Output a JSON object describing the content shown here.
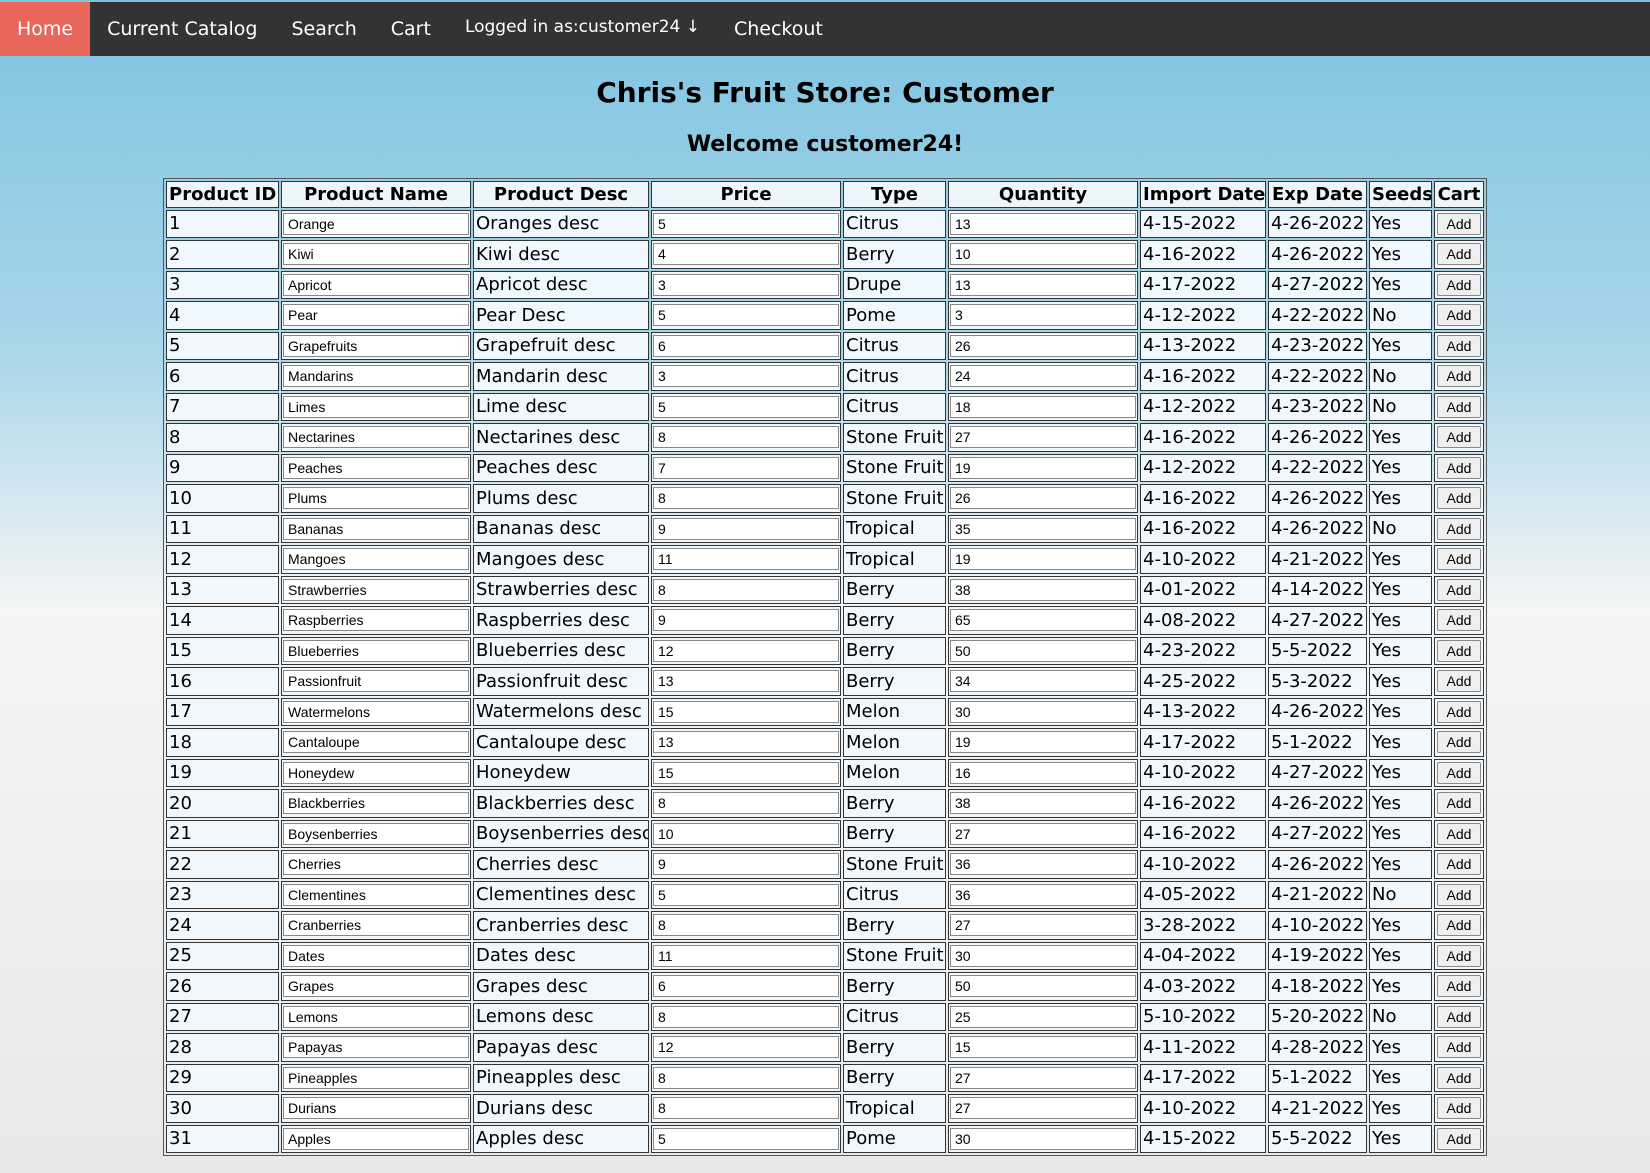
{
  "nav": {
    "home": "Home",
    "catalog": "Current Catalog",
    "search": "Search",
    "cart": "Cart",
    "user": "Logged in as:customer24 ↓",
    "checkout": "Checkout"
  },
  "colors": {
    "nav_background": "#333333",
    "nav_active": "#e8675a",
    "nav_text": "#ffffff"
  },
  "page": {
    "title": "Chris's Fruit Store: Customer",
    "welcome": "Welcome customer24!"
  },
  "table": {
    "headers": [
      "Product ID",
      "Product Name",
      "Product Desc",
      "Price",
      "Type",
      "Quantity",
      "Import Date",
      "Exp Date",
      "Seeds",
      "Cart"
    ],
    "add_label": "Add",
    "rows": [
      {
        "id": "1",
        "name": "Orange",
        "desc": "Oranges desc",
        "price": "5",
        "type": "Citrus",
        "quantity": "13",
        "import": "4-15-2022",
        "exp": "4-26-2022",
        "seeds": "Yes"
      },
      {
        "id": "2",
        "name": "Kiwi",
        "desc": "Kiwi desc",
        "price": "4",
        "type": "Berry",
        "quantity": "10",
        "import": "4-16-2022",
        "exp": "4-26-2022",
        "seeds": "Yes"
      },
      {
        "id": "3",
        "name": "Apricot",
        "desc": "Apricot desc",
        "price": "3",
        "type": "Drupe",
        "quantity": "13",
        "import": "4-17-2022",
        "exp": "4-27-2022",
        "seeds": "Yes"
      },
      {
        "id": "4",
        "name": "Pear",
        "desc": "Pear Desc",
        "price": "5",
        "type": "Pome",
        "quantity": "3",
        "import": "4-12-2022",
        "exp": "4-22-2022",
        "seeds": "No"
      },
      {
        "id": "5",
        "name": "Grapefruits",
        "desc": "Grapefruit desc",
        "price": "6",
        "type": "Citrus",
        "quantity": "26",
        "import": "4-13-2022",
        "exp": "4-23-2022",
        "seeds": "Yes"
      },
      {
        "id": "6",
        "name": "Mandarins",
        "desc": "Mandarin desc",
        "price": "3",
        "type": "Citrus",
        "quantity": "24",
        "import": "4-16-2022",
        "exp": "4-22-2022",
        "seeds": "No"
      },
      {
        "id": "7",
        "name": "Limes",
        "desc": "Lime desc",
        "price": "5",
        "type": "Citrus",
        "quantity": "18",
        "import": "4-12-2022",
        "exp": "4-23-2022",
        "seeds": "No"
      },
      {
        "id": "8",
        "name": "Nectarines",
        "desc": "Nectarines desc",
        "price": "8",
        "type": "Stone Fruit",
        "quantity": "27",
        "import": "4-16-2022",
        "exp": "4-26-2022",
        "seeds": "Yes"
      },
      {
        "id": "9",
        "name": "Peaches",
        "desc": "Peaches desc",
        "price": "7",
        "type": "Stone Fruit",
        "quantity": "19",
        "import": "4-12-2022",
        "exp": "4-22-2022",
        "seeds": "Yes"
      },
      {
        "id": "10",
        "name": "Plums",
        "desc": "Plums desc",
        "price": "8",
        "type": "Stone Fruit",
        "quantity": "26",
        "import": "4-16-2022",
        "exp": "4-26-2022",
        "seeds": "Yes"
      },
      {
        "id": "11",
        "name": "Bananas",
        "desc": "Bananas desc",
        "price": "9",
        "type": "Tropical",
        "quantity": "35",
        "import": "4-16-2022",
        "exp": "4-26-2022",
        "seeds": "No"
      },
      {
        "id": "12",
        "name": "Mangoes",
        "desc": "Mangoes desc",
        "price": "11",
        "type": "Tropical",
        "quantity": "19",
        "import": "4-10-2022",
        "exp": "4-21-2022",
        "seeds": "Yes"
      },
      {
        "id": "13",
        "name": "Strawberries",
        "desc": "Strawberries desc",
        "price": "8",
        "type": "Berry",
        "quantity": "38",
        "import": "4-01-2022",
        "exp": "4-14-2022",
        "seeds": "Yes"
      },
      {
        "id": "14",
        "name": "Raspberries",
        "desc": "Raspberries desc",
        "price": "9",
        "type": "Berry",
        "quantity": "65",
        "import": "4-08-2022",
        "exp": "4-27-2022",
        "seeds": "Yes"
      },
      {
        "id": "15",
        "name": "Blueberries",
        "desc": "Blueberries desc",
        "price": "12",
        "type": "Berry",
        "quantity": "50",
        "import": "4-23-2022",
        "exp": "5-5-2022",
        "seeds": "Yes"
      },
      {
        "id": "16",
        "name": "Passionfruit",
        "desc": "Passionfruit desc",
        "price": "13",
        "type": "Berry",
        "quantity": "34",
        "import": "4-25-2022",
        "exp": "5-3-2022",
        "seeds": "Yes"
      },
      {
        "id": "17",
        "name": "Watermelons",
        "desc": "Watermelons desc",
        "price": "15",
        "type": "Melon",
        "quantity": "30",
        "import": "4-13-2022",
        "exp": "4-26-2022",
        "seeds": "Yes"
      },
      {
        "id": "18",
        "name": "Cantaloupe",
        "desc": "Cantaloupe desc",
        "price": "13",
        "type": "Melon",
        "quantity": "19",
        "import": "4-17-2022",
        "exp": "5-1-2022",
        "seeds": "Yes"
      },
      {
        "id": "19",
        "name": "Honeydew",
        "desc": "Honeydew",
        "price": "15",
        "type": "Melon",
        "quantity": "16",
        "import": "4-10-2022",
        "exp": "4-27-2022",
        "seeds": "Yes"
      },
      {
        "id": "20",
        "name": "Blackberries",
        "desc": "Blackberries desc",
        "price": "8",
        "type": "Berry",
        "quantity": "38",
        "import": "4-16-2022",
        "exp": "4-26-2022",
        "seeds": "Yes"
      },
      {
        "id": "21",
        "name": "Boysenberries",
        "desc": "Boysenberries desc",
        "price": "10",
        "type": "Berry",
        "quantity": "27",
        "import": "4-16-2022",
        "exp": "4-27-2022",
        "seeds": "Yes"
      },
      {
        "id": "22",
        "name": "Cherries",
        "desc": "Cherries desc",
        "price": "9",
        "type": "Stone Fruit",
        "quantity": "36",
        "import": "4-10-2022",
        "exp": "4-26-2022",
        "seeds": "Yes"
      },
      {
        "id": "23",
        "name": "Clementines",
        "desc": "Clementines desc",
        "price": "5",
        "type": "Citrus",
        "quantity": "36",
        "import": "4-05-2022",
        "exp": "4-21-2022",
        "seeds": "No"
      },
      {
        "id": "24",
        "name": "Cranberries",
        "desc": "Cranberries desc",
        "price": "8",
        "type": "Berry",
        "quantity": "27",
        "import": "3-28-2022",
        "exp": "4-10-2022",
        "seeds": "Yes"
      },
      {
        "id": "25",
        "name": "Dates",
        "desc": "Dates desc",
        "price": "11",
        "type": "Stone Fruit",
        "quantity": "30",
        "import": "4-04-2022",
        "exp": "4-19-2022",
        "seeds": "Yes"
      },
      {
        "id": "26",
        "name": "Grapes",
        "desc": "Grapes desc",
        "price": "6",
        "type": "Berry",
        "quantity": "50",
        "import": "4-03-2022",
        "exp": "4-18-2022",
        "seeds": "Yes"
      },
      {
        "id": "27",
        "name": "Lemons",
        "desc": "Lemons desc",
        "price": "8",
        "type": "Citrus",
        "quantity": "25",
        "import": "5-10-2022",
        "exp": "5-20-2022",
        "seeds": "No"
      },
      {
        "id": "28",
        "name": "Papayas",
        "desc": "Papayas desc",
        "price": "12",
        "type": "Berry",
        "quantity": "15",
        "import": "4-11-2022",
        "exp": "4-28-2022",
        "seeds": "Yes"
      },
      {
        "id": "29",
        "name": "Pineapples",
        "desc": "Pineapples desc",
        "price": "8",
        "type": "Berry",
        "quantity": "27",
        "import": "4-17-2022",
        "exp": "5-1-2022",
        "seeds": "Yes"
      },
      {
        "id": "30",
        "name": "Durians",
        "desc": "Durians desc",
        "price": "8",
        "type": "Tropical",
        "quantity": "27",
        "import": "4-10-2022",
        "exp": "4-21-2022",
        "seeds": "Yes"
      },
      {
        "id": "31",
        "name": "Apples",
        "desc": "Apples desc",
        "price": "5",
        "type": "Pome",
        "quantity": "30",
        "import": "4-15-2022",
        "exp": "5-5-2022",
        "seeds": "Yes"
      }
    ]
  }
}
